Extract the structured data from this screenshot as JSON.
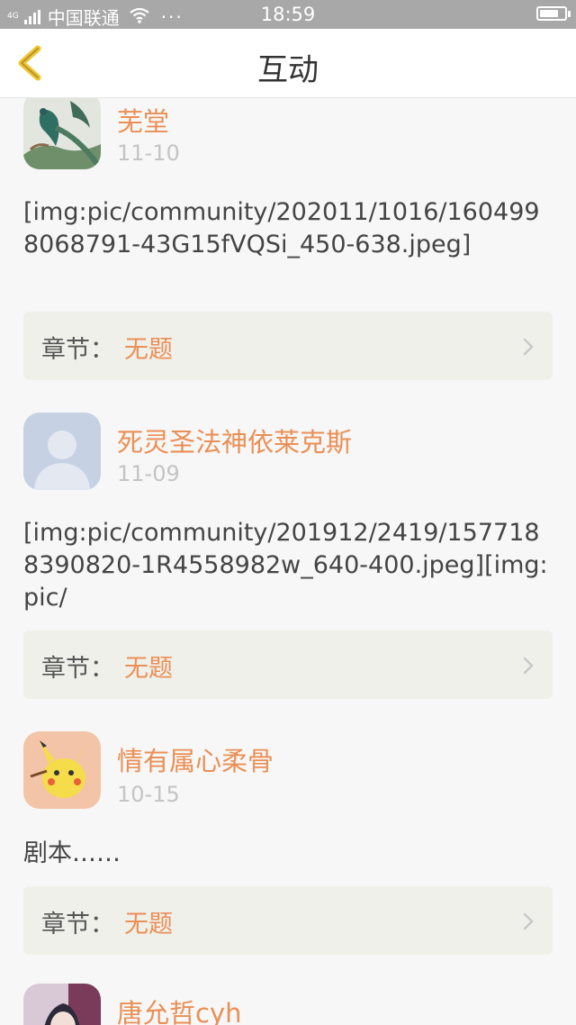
{
  "status_bar": {
    "network_type": "4G",
    "carrier": "中国联通",
    "more_dots": "···",
    "time": "18:59",
    "battery_level": 0.75
  },
  "header": {
    "title": "互动",
    "back_icon": "chevron-left-icon",
    "accent_color": "#f2c530"
  },
  "colors": {
    "author": "#ea8f55",
    "chapter_value": "#ea8f55",
    "date": "#c4c4c4"
  },
  "posts": [
    {
      "author": "芜堂",
      "date": "11-10",
      "content": "[img:pic/community/202011/1016/1604998068791-43G15fVQSi_450-638.jpeg]",
      "chapter_label": "章节：",
      "chapter_value": "无题",
      "avatar": "peacock-painting"
    },
    {
      "author": "死灵圣法神依莱克斯",
      "date": "11-09",
      "content": "[img:pic/community/201912/2419/1577188390820-1R4558982w_640-400.jpeg][img:pic/",
      "chapter_label": "章节：",
      "chapter_value": "无题",
      "avatar": "default-user-silhouette"
    },
    {
      "author": "情有属心柔骨",
      "date": "10-15",
      "content": "剧本……",
      "chapter_label": "章节：",
      "chapter_value": "无题",
      "avatar": "pikachu-cartoon"
    },
    {
      "author": "唐允哲cyh",
      "avatar": "anime-character"
    }
  ]
}
